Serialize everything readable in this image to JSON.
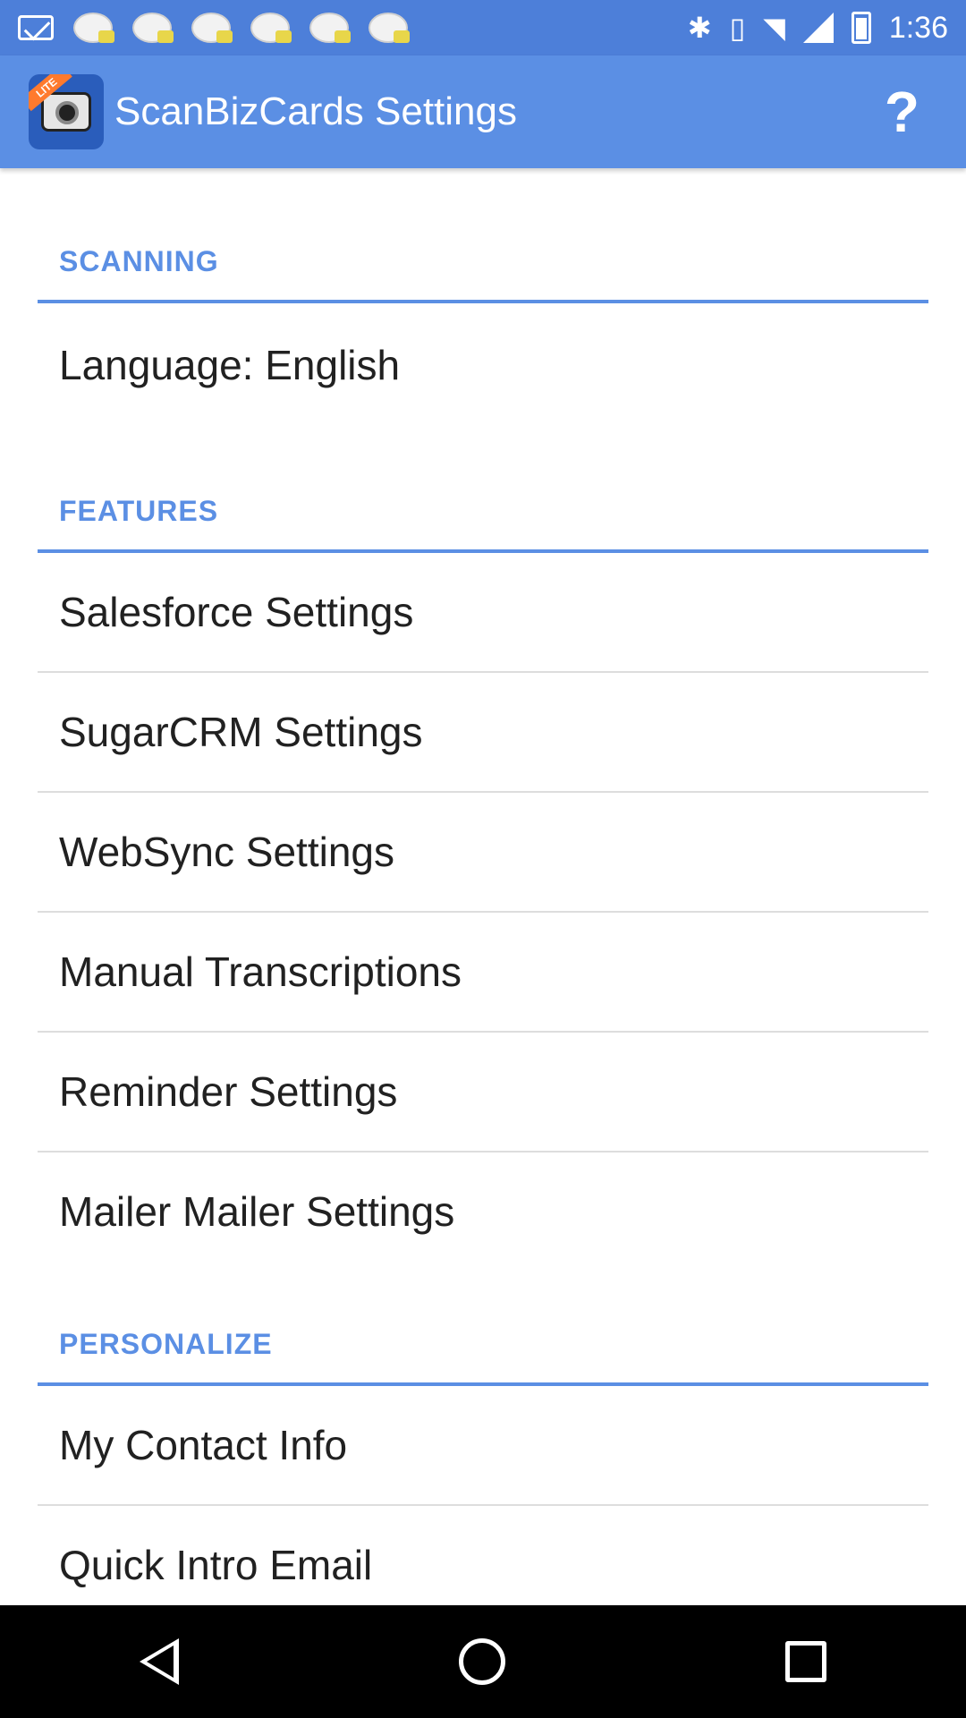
{
  "status_bar": {
    "time": "1:36",
    "icons": [
      "mail-icon",
      "ball-icon",
      "ball-icon",
      "ball-icon",
      "ball-icon",
      "ball-icon",
      "ball-icon",
      "ball-icon",
      "ball-icon",
      "ball-icon",
      "ball-icon",
      "bluetooth-icon",
      "vibrate-icon",
      "wifi-icon",
      "signal-icon",
      "battery-icon"
    ]
  },
  "app_bar": {
    "title": "ScanBizCards Settings",
    "badge": "LITE",
    "help": "?"
  },
  "sections": {
    "scanning": {
      "header": "SCANNING",
      "items": [
        "Language: English"
      ]
    },
    "features": {
      "header": "FEATURES",
      "items": [
        "Salesforce Settings",
        "SugarCRM Settings",
        "WebSync Settings",
        "Manual Transcriptions",
        "Reminder Settings",
        "Mailer Mailer Settings"
      ]
    },
    "personalize": {
      "header": "PERSONALIZE",
      "items": [
        "My Contact Info",
        "Quick Intro Email"
      ]
    }
  },
  "colors": {
    "accent": "#5b8fe4",
    "status_bar": "#4d7fd9"
  }
}
